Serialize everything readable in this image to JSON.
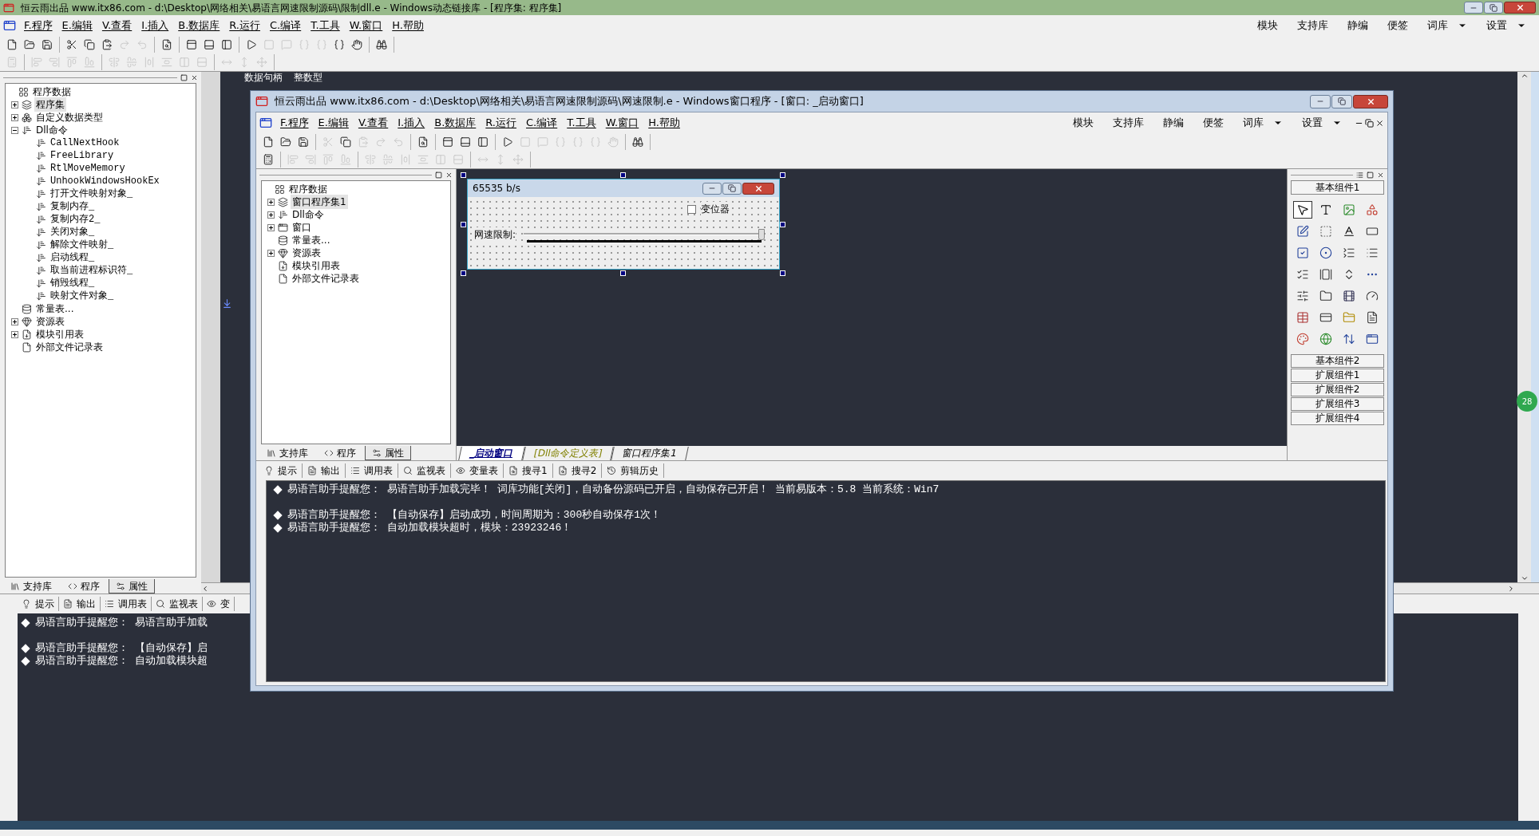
{
  "outer_window": {
    "title": "恒云雨出品 www.itx86.com - d:\\Desktop\\网络相关\\易语言网速限制源码\\限制dll.e - Windows动态链接库 - [程序集: 程序集]",
    "menu": [
      "F.程序",
      "E.编辑",
      "V.查看",
      "I.插入",
      "B.数据库",
      "R.运行",
      "C.编译",
      "T.工具",
      "W.窗口",
      "H.帮助"
    ],
    "menu_right": [
      {
        "label": "模块",
        "dropdown": false
      },
      {
        "label": "支持库",
        "dropdown": false
      },
      {
        "label": "静编",
        "dropdown": false
      },
      {
        "label": "便签",
        "dropdown": false
      },
      {
        "label": "词库",
        "dropdown": true
      },
      {
        "label": "设置",
        "dropdown": true
      }
    ],
    "toolbar": [
      [
        {
          "kind": "new",
          "disabled": false
        },
        {
          "kind": "open",
          "disabled": false
        },
        {
          "kind": "save",
          "disabled": false
        }
      ],
      [
        {
          "kind": "cut",
          "disabled": false
        },
        {
          "kind": "copy",
          "disabled": false
        },
        {
          "kind": "paste",
          "disabled": false
        },
        {
          "kind": "redo",
          "disabled": true
        },
        {
          "kind": "undo",
          "disabled": true
        }
      ],
      [
        {
          "kind": "find",
          "disabled": false
        }
      ],
      [
        {
          "kind": "layout_top",
          "disabled": false
        },
        {
          "kind": "layout_bottom",
          "disabled": false
        },
        {
          "kind": "layout_side",
          "disabled": false
        }
      ],
      [
        {
          "kind": "run",
          "disabled": false
        },
        {
          "kind": "stop",
          "disabled": true
        },
        {
          "kind": "step_comment",
          "disabled": true
        },
        {
          "kind": "step_in",
          "disabled": true
        },
        {
          "kind": "step_over",
          "disabled": true
        },
        {
          "kind": "step_out",
          "disabled": false
        },
        {
          "kind": "hand",
          "disabled": false
        }
      ],
      [
        {
          "kind": "help",
          "disabled": false
        }
      ]
    ],
    "align_toolbar": [
      [
        {
          "kind": "grid",
          "disabled": true
        }
      ],
      [
        {
          "kind": "align_left",
          "disabled": true
        },
        {
          "kind": "align_right",
          "disabled": true
        },
        {
          "kind": "align_top",
          "disabled": true
        },
        {
          "kind": "align_bottom",
          "disabled": true
        }
      ],
      [
        {
          "kind": "center_h",
          "disabled": true
        },
        {
          "kind": "center_v",
          "disabled": true
        },
        {
          "kind": "space_h",
          "disabled": true
        },
        {
          "kind": "space_v",
          "disabled": true
        },
        {
          "kind": "spread_h",
          "disabled": true
        },
        {
          "kind": "spread_v",
          "disabled": true
        }
      ],
      [
        {
          "kind": "same_width",
          "disabled": true
        },
        {
          "kind": "same_height",
          "disabled": true
        },
        {
          "kind": "same_size",
          "disabled": true
        }
      ]
    ],
    "tree": {
      "label": "程序数据",
      "kind": "root",
      "selected": false,
      "children": [
        {
          "label": "程序集",
          "kind": "program_set",
          "expanded": false,
          "selected": true
        },
        {
          "label": "自定义数据类型",
          "kind": "datatype",
          "expanded": false,
          "selected": false
        },
        {
          "label": "Dll命令",
          "kind": "dll",
          "expanded": true,
          "selected": false,
          "children": [
            {
              "label": "CallNextHook",
              "kind": "dll",
              "selected": false
            },
            {
              "label": "FreeLibrary",
              "kind": "dll",
              "selected": false
            },
            {
              "label": "RtlMoveMemory",
              "kind": "dll",
              "selected": false
            },
            {
              "label": "UnhookWindowsHookEx",
              "kind": "dll",
              "selected": false
            },
            {
              "label": "打开文件映射对象_",
              "kind": "dll",
              "selected": false
            },
            {
              "label": "复制内存_",
              "kind": "dll",
              "selected": false
            },
            {
              "label": "复制内存2_",
              "kind": "dll",
              "selected": false
            },
            {
              "label": "关闭对象_",
              "kind": "dll",
              "selected": false
            },
            {
              "label": "解除文件映射_",
              "kind": "dll",
              "selected": false
            },
            {
              "label": "启动线程_",
              "kind": "dll",
              "selected": false
            },
            {
              "label": "取当前进程标识符_",
              "kind": "dll",
              "selected": false
            },
            {
              "label": "销毁线程_",
              "kind": "dll",
              "selected": false
            },
            {
              "label": "映射文件对象_",
              "kind": "dll",
              "selected": false
            }
          ]
        },
        {
          "label": "常量表...",
          "kind": "constants",
          "selected": false
        },
        {
          "label": "资源表",
          "kind": "resources",
          "expanded": false,
          "selected": false
        },
        {
          "label": "模块引用表",
          "kind": "modules",
          "expanded": false,
          "selected": false
        },
        {
          "label": "外部文件记录表",
          "kind": "files",
          "selected": false
        }
      ]
    },
    "panel_tabs": [
      {
        "label": "支持库",
        "kind": "library",
        "selected": false
      },
      {
        "label": "程序",
        "kind": "program",
        "selected": false
      },
      {
        "label": "属性",
        "kind": "properties",
        "selected": true
      }
    ],
    "code_header": [
      "数据句柄",
      "整数型"
    ],
    "output_tabs": [
      {
        "label": "提示",
        "kind": "tip"
      },
      {
        "label": "输出",
        "kind": "output"
      },
      {
        "label": "调用表",
        "kind": "calls"
      },
      {
        "label": "监视表",
        "kind": "watch"
      },
      {
        "label": "变",
        "kind": "vars"
      }
    ],
    "output_blocks": [
      [
        {
          "prefix": "易语言助手提醒您：",
          "text": "易语言助手加载"
        }
      ],
      [
        {
          "prefix": "易语言助手提醒您：",
          "text": "【自动保存】启"
        },
        {
          "prefix": "易语言助手提醒您：",
          "text": "自动加载模块超"
        }
      ]
    ],
    "badge": "28"
  },
  "inner_window": {
    "title": "恒云雨出品 www.itx86.com - d:\\Desktop\\网络相关\\易语言网速限制源码\\网速限制.e - Windows窗口程序 - [窗口: _启动窗口]",
    "menu": [
      "F.程序",
      "E.编辑",
      "V.查看",
      "I.插入",
      "B.数据库",
      "R.运行",
      "C.编译",
      "T.工具",
      "W.窗口",
      "H.帮助"
    ],
    "menu_right": [
      {
        "label": "模块",
        "dropdown": false
      },
      {
        "label": "支持库",
        "dropdown": false
      },
      {
        "label": "静编",
        "dropdown": false
      },
      {
        "label": "便签",
        "dropdown": false
      },
      {
        "label": "词库",
        "dropdown": true
      },
      {
        "label": "设置",
        "dropdown": true
      }
    ],
    "toolbar": [
      [
        {
          "kind": "new",
          "disabled": false
        },
        {
          "kind": "open",
          "disabled": false
        },
        {
          "kind": "save",
          "disabled": false
        }
      ],
      [
        {
          "kind": "cut",
          "disabled": true
        },
        {
          "kind": "copy",
          "disabled": false
        },
        {
          "kind": "paste",
          "disabled": true
        },
        {
          "kind": "redo",
          "disabled": true
        },
        {
          "kind": "undo",
          "disabled": true
        }
      ],
      [
        {
          "kind": "find",
          "disabled": false
        }
      ],
      [
        {
          "kind": "layout_top",
          "disabled": false
        },
        {
          "kind": "layout_bottom",
          "disabled": false
        },
        {
          "kind": "layout_side",
          "disabled": false
        }
      ],
      [
        {
          "kind": "run",
          "disabled": false
        },
        {
          "kind": "stop",
          "disabled": true
        },
        {
          "kind": "step_comment",
          "disabled": true
        },
        {
          "kind": "step_in",
          "disabled": true
        },
        {
          "kind": "step_over",
          "disabled": true
        },
        {
          "kind": "step_out",
          "disabled": true
        },
        {
          "kind": "hand",
          "disabled": true
        }
      ],
      [
        {
          "kind": "help",
          "disabled": false
        }
      ]
    ],
    "align_toolbar": [
      [
        {
          "kind": "grid",
          "disabled": false
        }
      ],
      [
        {
          "kind": "align_left",
          "disabled": true
        },
        {
          "kind": "align_right",
          "disabled": true
        },
        {
          "kind": "align_top",
          "disabled": true
        },
        {
          "kind": "align_bottom",
          "disabled": true
        }
      ],
      [
        {
          "kind": "center_h",
          "disabled": true
        },
        {
          "kind": "center_v",
          "disabled": true
        },
        {
          "kind": "space_h",
          "disabled": true
        },
        {
          "kind": "space_v",
          "disabled": true
        },
        {
          "kind": "spread_h",
          "disabled": true
        },
        {
          "kind": "spread_v",
          "disabled": true
        }
      ],
      [
        {
          "kind": "same_width",
          "disabled": true
        },
        {
          "kind": "same_height",
          "disabled": true
        },
        {
          "kind": "same_size",
          "disabled": true
        }
      ]
    ],
    "tree": {
      "label": "程序数据",
      "kind": "root",
      "selected": false,
      "children": [
        {
          "label": "窗口程序集1",
          "kind": "program_set",
          "expanded": false,
          "selected": true
        },
        {
          "label": "Dll命令",
          "kind": "dll",
          "expanded": false,
          "selected": false
        },
        {
          "label": "窗口",
          "kind": "window",
          "expanded": false,
          "selected": false
        },
        {
          "label": "常量表...",
          "kind": "constants",
          "selected": false
        },
        {
          "label": "资源表",
          "kind": "resources",
          "expanded": false,
          "selected": false
        },
        {
          "label": "模块引用表",
          "kind": "modules",
          "selected": false
        },
        {
          "label": "外部文件记录表",
          "kind": "files",
          "selected": false
        }
      ]
    },
    "panel_tabs": [
      {
        "label": "支持库",
        "kind": "library",
        "selected": false
      },
      {
        "label": "程序",
        "kind": "program",
        "selected": false
      },
      {
        "label": "属性",
        "kind": "properties",
        "selected": true
      }
    ],
    "form": {
      "title": "65535 b/s",
      "checkbox": {
        "label": "变位器",
        "checked": false
      },
      "slider_label": "网速限制:",
      "slider": {
        "level": 1
      }
    },
    "designer_tabs": [
      {
        "label": "_启动窗口",
        "selected": true,
        "color": "#000080"
      },
      {
        "label": "[Dll命令定义表]",
        "selected": false,
        "color": "#808000"
      },
      {
        "label": "窗口程序集1",
        "selected": false,
        "color": "#000000"
      }
    ],
    "palette": {
      "title": "基本组件1",
      "tools": [
        {
          "kind": "pointer",
          "selected": true
        },
        {
          "kind": "label",
          "selected": false
        },
        {
          "kind": "picture",
          "selected": false
        },
        {
          "kind": "shape",
          "selected": false
        },
        {
          "kind": "edit",
          "selected": false
        },
        {
          "kind": "groupbox",
          "selected": false
        },
        {
          "kind": "font",
          "selected": false
        },
        {
          "kind": "button",
          "selected": false
        },
        {
          "kind": "checkbox",
          "selected": false
        },
        {
          "kind": "radio",
          "selected": false
        },
        {
          "kind": "combobox",
          "selected": false
        },
        {
          "kind": "listbox",
          "selected": false
        },
        {
          "kind": "checklist",
          "selected": false
        },
        {
          "kind": "scrollbar",
          "selected": false
        },
        {
          "kind": "spin",
          "selected": false
        },
        {
          "kind": "progress",
          "selected": false
        },
        {
          "kind": "slider",
          "selected": false
        },
        {
          "kind": "tab",
          "selected": false
        },
        {
          "kind": "animation",
          "selected": false
        },
        {
          "kind": "frame",
          "selected": false
        },
        {
          "kind": "table",
          "selected": false
        },
        {
          "kind": "status",
          "selected": false
        },
        {
          "kind": "dir",
          "selected": false
        },
        {
          "kind": "file",
          "selected": false
        },
        {
          "kind": "colorpicker",
          "selected": false
        },
        {
          "kind": "network",
          "selected": false
        },
        {
          "kind": "updown",
          "selected": false
        },
        {
          "kind": "window",
          "selected": false
        }
      ],
      "groups": [
        "基本组件2",
        "扩展组件1",
        "扩展组件2",
        "扩展组件3",
        "扩展组件4"
      ]
    },
    "output_tabs": [
      {
        "label": "提示",
        "kind": "tip"
      },
      {
        "label": "输出",
        "kind": "output"
      },
      {
        "label": "调用表",
        "kind": "calls"
      },
      {
        "label": "监视表",
        "kind": "watch"
      },
      {
        "label": "变量表",
        "kind": "vars"
      },
      {
        "label": "搜寻1",
        "kind": "search"
      },
      {
        "label": "搜寻2",
        "kind": "search"
      },
      {
        "label": "剪辑历史",
        "kind": "history"
      }
    ],
    "output_blocks": [
      [
        {
          "prefix": "易语言助手提醒您：",
          "text": "易语言助手加载完毕！ 词库功能[关闭]，自动备份源码已开启，自动保存已开启！ 当前易版本：5.8  当前系统：Win7"
        }
      ],
      [
        {
          "prefix": "易语言助手提醒您：",
          "text": "【自动保存】启动成功，时间周期为：300秒自动保存1次！"
        },
        {
          "prefix": "易语言助手提醒您：",
          "text": "自动加载模块超时，模块：23923246！"
        }
      ]
    ]
  }
}
